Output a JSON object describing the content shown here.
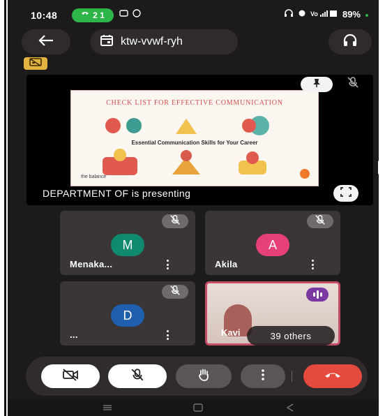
{
  "status_bar": {
    "time": "10:48",
    "call_pill": "2 1",
    "battery": "89%"
  },
  "top_bar": {
    "meeting_code": "ktw-vvwf-ryh"
  },
  "presentation": {
    "slide_title": "CHECK LIST FOR EFFECTIVE COMMUNICATION",
    "slide_subtitle": "Essential Communication Skills for Your Career",
    "slide_brand": "the balance",
    "presenter_text": "DEPARTMENT OF  is presenting"
  },
  "participants": [
    {
      "name": "Menaka...",
      "initial": "M",
      "avatar_color": "#0f8a6f"
    },
    {
      "name": "Akila",
      "initial": "A",
      "avatar_color": "#e8417a"
    },
    {
      "name": "...",
      "initial": "D",
      "avatar_color": "#1f5fae"
    }
  ],
  "video_tile": {
    "name": "Kavi",
    "others_label": "39 others"
  },
  "colors": {
    "background": "#1d1a1b",
    "leave_button": "#e6493d",
    "speaking": "#7b3aa3",
    "pill_green": "#2db54a"
  },
  "icons": {
    "back": "arrow-left-icon",
    "meeting": "calendar-icon",
    "audio": "headphones-icon",
    "pin": "pin-icon",
    "mic_off": "mic-off-icon",
    "fullscreen": "fullscreen-icon",
    "camera_off": "camera-off-icon",
    "raise_hand": "hand-icon",
    "more": "more-vertical-icon",
    "leave": "phone-hangup-icon"
  }
}
